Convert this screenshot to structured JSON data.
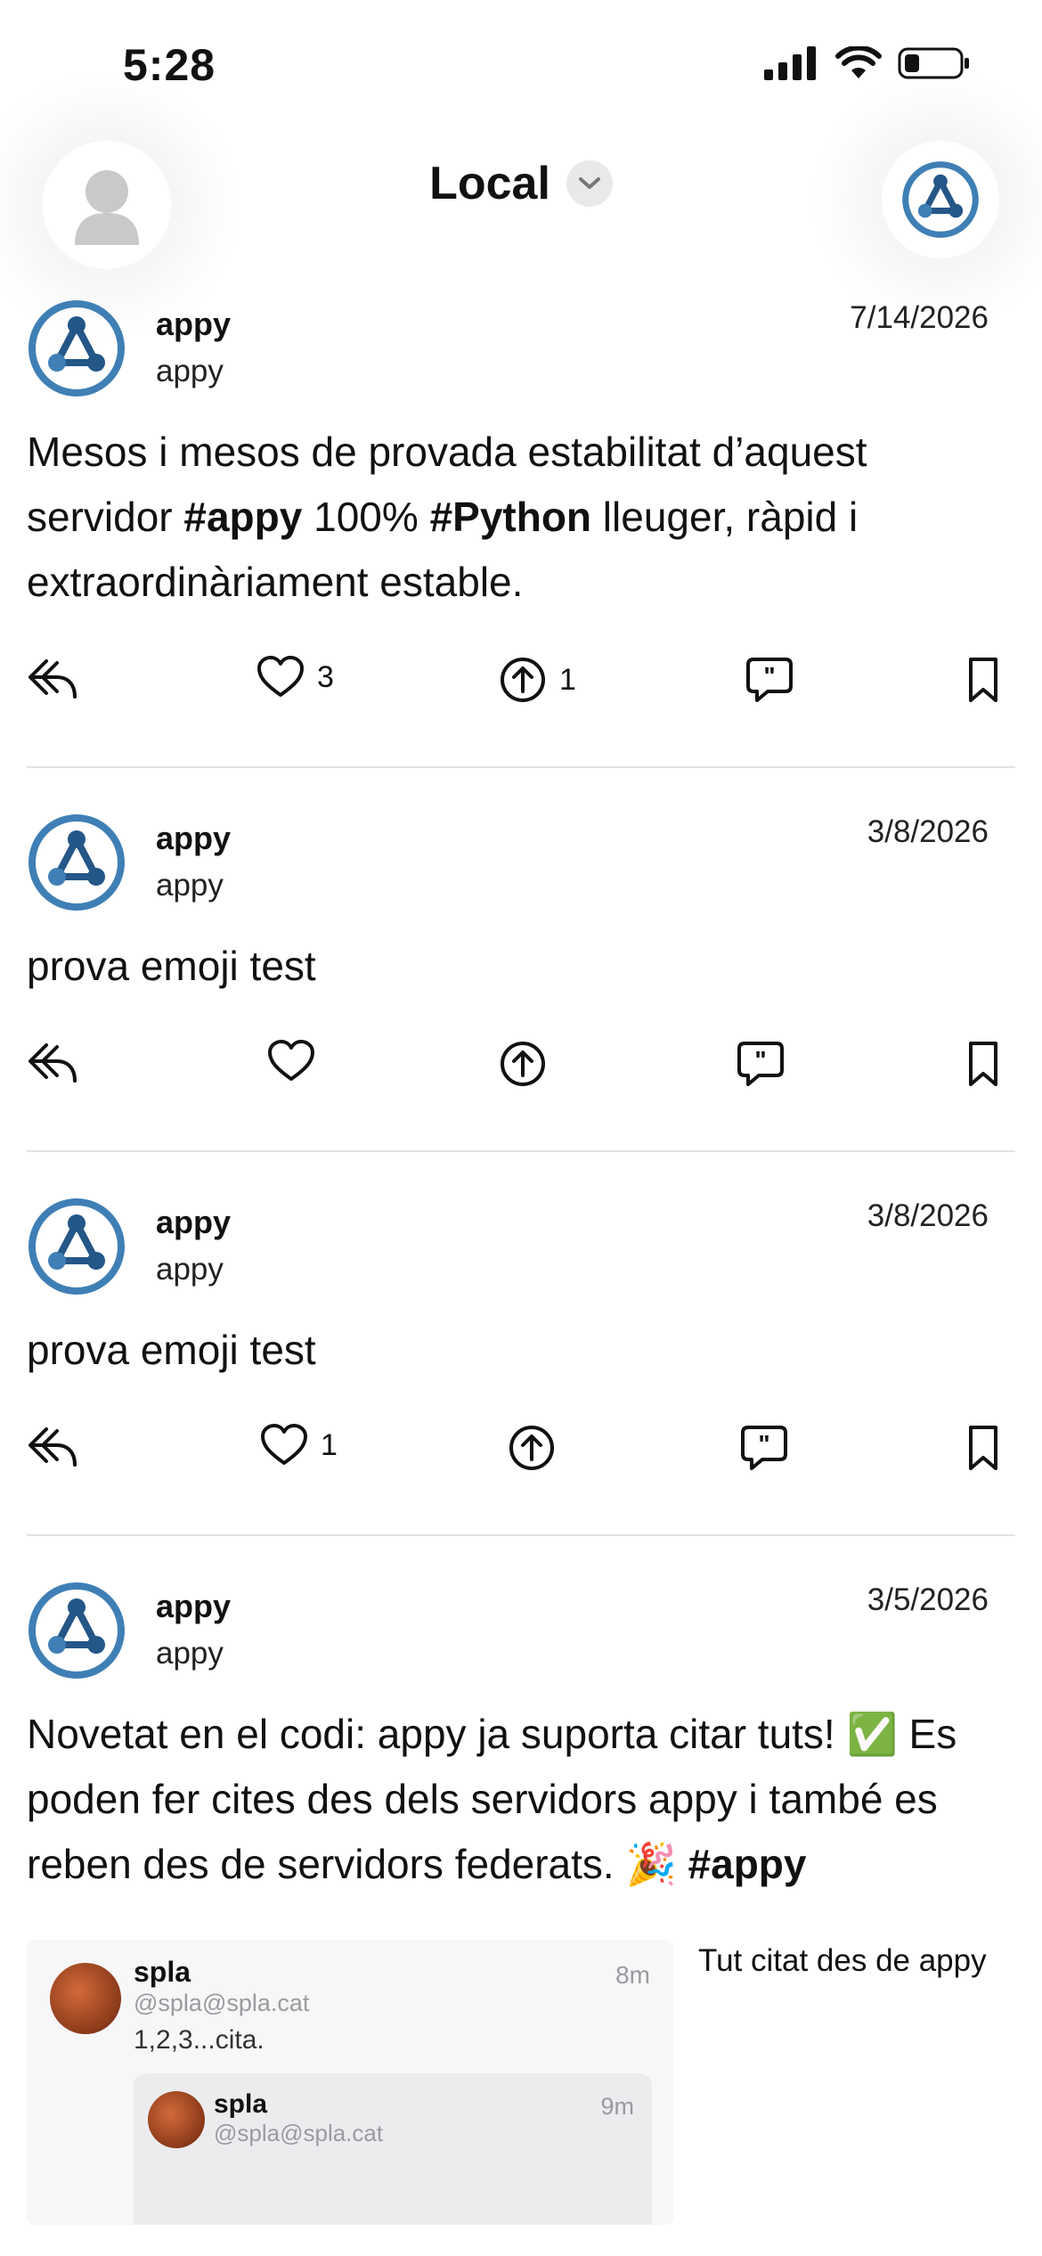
{
  "status_bar": {
    "time": "5:28",
    "icons": [
      "cellular-signal-icon",
      "wifi-icon",
      "battery-icon"
    ]
  },
  "header": {
    "title": "Local",
    "left_button": "profile-avatar-icon",
    "right_button": "appy-logo-icon"
  },
  "posts": [
    {
      "name": "appy",
      "handle": "appy",
      "date": "7/14/2026",
      "body_parts": [
        {
          "t": "Mesos i mesos de provada estabilitat d’aquest servidor "
        },
        {
          "t": "#appy",
          "b": true
        },
        {
          "t": " 100% "
        },
        {
          "t": "#Python",
          "b": true
        },
        {
          "t": " lleuger, ràpid i extraordinàriament estable."
        }
      ],
      "likes": "3",
      "boosts": "1"
    },
    {
      "name": "appy",
      "handle": "appy",
      "date": "3/8/2026",
      "body_parts": [
        {
          "t": "prova emoji  test"
        }
      ],
      "likes": "",
      "boosts": ""
    },
    {
      "name": "appy",
      "handle": "appy",
      "date": "3/8/2026",
      "body_parts": [
        {
          "t": "prova emoji  test"
        }
      ],
      "likes": "1",
      "boosts": ""
    },
    {
      "name": "appy",
      "handle": "appy",
      "date": "3/5/2026",
      "body_parts": [
        {
          "t": "Novetat en el codi: appy ja suporta citar tuts! ✅ Es poden fer cites des dels servidors appy i també es reben des de servidors federats. 🎉 "
        },
        {
          "t": "#appy",
          "b": true
        }
      ],
      "likes": "",
      "boosts": "",
      "quote": {
        "name": "spla",
        "handle": "@spla@spla.cat",
        "time": "8m",
        "text": "1,2,3...cita.",
        "inner": {
          "name": "spla",
          "handle": "@spla@spla.cat",
          "time": "9m"
        },
        "label": "Tut citat des de appy"
      }
    }
  ],
  "colors": {
    "logo_blue": "#3f7fb5",
    "logo_dark": "#245688",
    "divider": "#e3e3e3"
  }
}
